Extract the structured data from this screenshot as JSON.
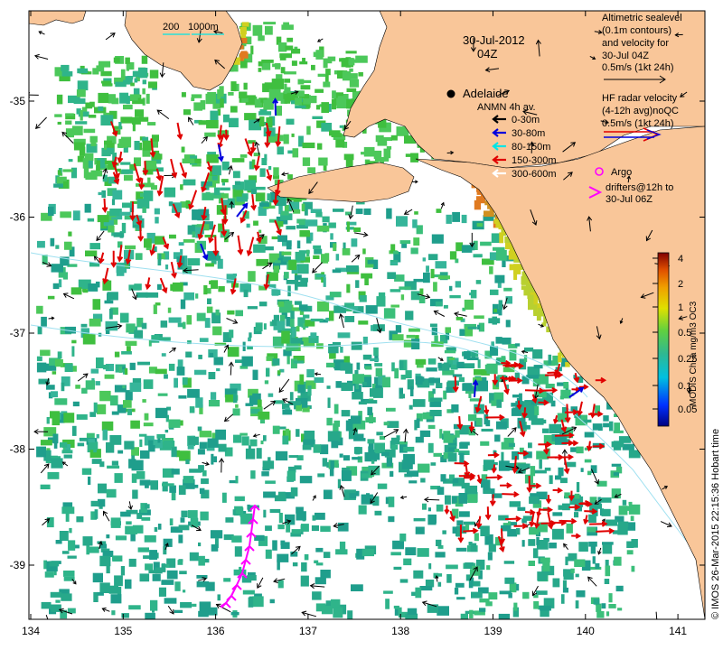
{
  "title": {
    "date": "30-Jul-2012",
    "time": "04Z"
  },
  "scale_bar": {
    "label_a": "200",
    "label_b": "1000m"
  },
  "place": {
    "city": "Adelaide"
  },
  "legend_altimetry": {
    "line1": "Altimetric sealevel",
    "line2": "(0.1m contours)",
    "line3": "and velocity for",
    "line4": "30-Jul 04Z",
    "line5": "0.5m/s (1kt 24h)"
  },
  "legend_radar": {
    "line1": "HF radar velocity",
    "line2": "(4-12h avg)noQC",
    "line3": "0.5m/s (1kt 24h)"
  },
  "legend_anmn": {
    "title": "ANMN 4h av.",
    "items": [
      {
        "label": "0-30m",
        "color": "#000000"
      },
      {
        "label": "30-80m",
        "color": "#0000dd"
      },
      {
        "label": "80-150m",
        "color": "#00e5e5"
      },
      {
        "label": "150-300m",
        "color": "#e00000"
      },
      {
        "label": "300-600m",
        "color": "#ffffff"
      }
    ]
  },
  "legend_argo": {
    "line1": "Argo",
    "line2": "drifters@12h to",
    "line3": "30-Jul 06Z",
    "color": "#ff00ff"
  },
  "colorbar": {
    "title": "MODIS Chl-a mg/m3 OC3",
    "ticks": [
      "4",
      "2",
      "1",
      "0.5",
      "0.25",
      "0.1",
      "0.05"
    ]
  },
  "axes": {
    "x_ticks": [
      "134",
      "135",
      "136",
      "137",
      "138",
      "139",
      "140",
      "141"
    ],
    "y_ticks": [
      "-35",
      "-36",
      "-37",
      "-38",
      "-39"
    ]
  },
  "credit": "© IMOS 26-Mar-2015 22:15:36 Hobart time",
  "colors": {
    "land": "#f9c699",
    "chl_low": "#1f9e8c",
    "chl_mid": "#3fbf3f",
    "chl_high": "#d0d020",
    "chl_peak": "#e07a20"
  }
}
